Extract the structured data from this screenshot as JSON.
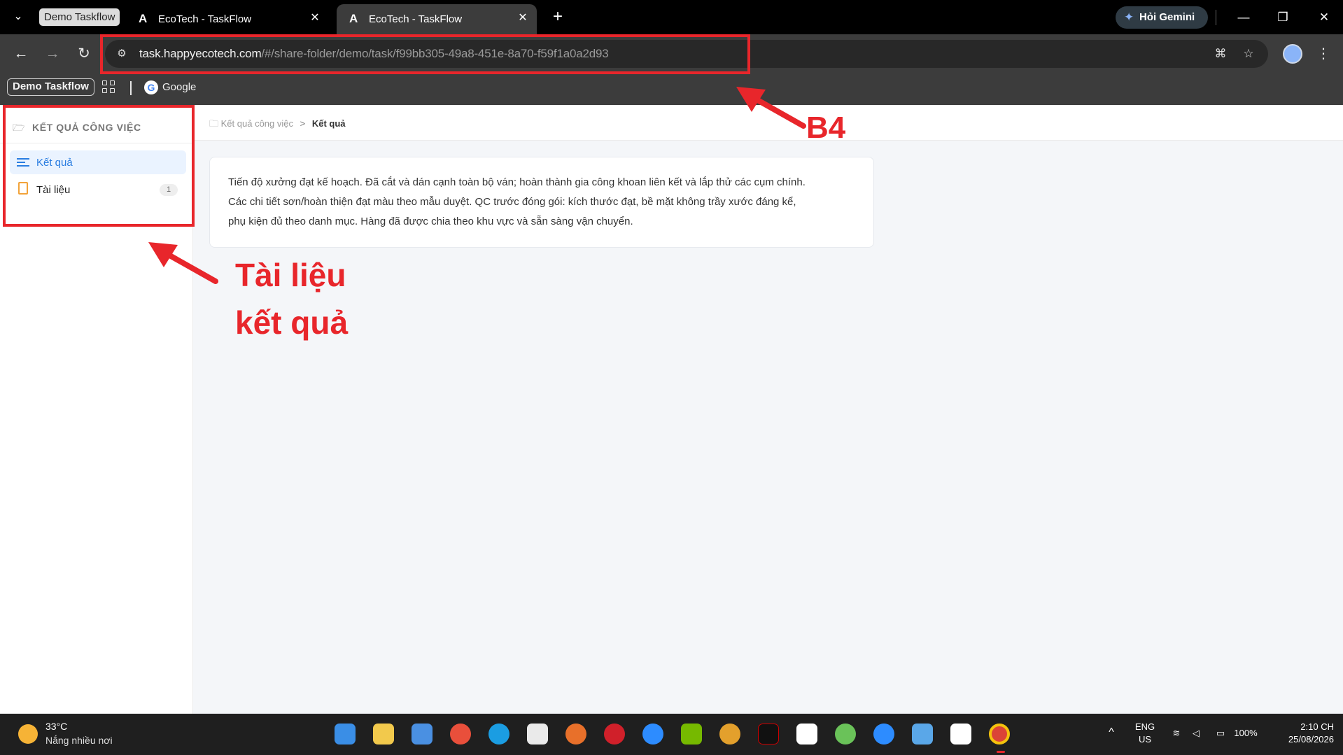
{
  "browser": {
    "tab_group": "Demo Taskflow",
    "tabs": [
      {
        "title": "EcoTech - TaskFlow",
        "favicon": "A"
      },
      {
        "title": "EcoTech - TaskFlow",
        "favicon": "A"
      }
    ],
    "gemini_label": "Hỏi Gemini",
    "url_host": "task.happyecotech.com",
    "url_path": "/#/share-folder/demo/task/f99bb305-49a8-451e-8a70-f59f1a0a2d93",
    "bookmarks": {
      "chip": "Demo Taskflow",
      "google": "Google"
    }
  },
  "sidebar": {
    "header": "KẾT QUẢ CÔNG VIỆC",
    "items": [
      {
        "label": "Kết quả",
        "icon": "list-icon",
        "active": true
      },
      {
        "label": "Tài liệu",
        "icon": "document-icon",
        "badge": "1"
      }
    ]
  },
  "breadcrumb": {
    "parent": "Kết quả công việc",
    "current": "Kết quả"
  },
  "note": {
    "line1": "Tiến độ xưởng đạt kế hoạch. Đã cắt và dán cạnh toàn bộ ván; hoàn thành gia công khoan liên kết và lắp thử các cụm chính.",
    "line2": "Các chi tiết sơn/hoàn thiện đạt màu theo mẫu duyệt. QC trước đóng gói: kích thước đạt, bề mặt không trầy xước đáng kể,",
    "line3": "phụ kiện đủ theo danh mục. Hàng đã được chia theo khu vực và sẵn sàng vận chuyển."
  },
  "annotations": {
    "step_label": "B4",
    "sidebar_label_line1": "Tài liệu",
    "sidebar_label_line2": "kết quả",
    "color": "#e8262b"
  },
  "taskbar": {
    "weather_temp": "33°C",
    "weather_desc": "Nắng nhiều nơi",
    "lang_top": "ENG",
    "lang_bottom": "US",
    "battery": "100%",
    "time": "2:10 CH",
    "date": "25/08/2026"
  }
}
